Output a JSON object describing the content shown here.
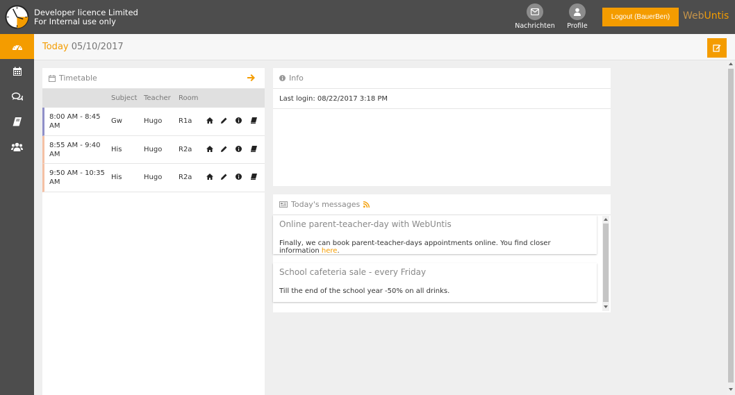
{
  "header": {
    "licence_line1": "Developer licence Limited",
    "licence_line2": "For Internal use only",
    "messages_label": "Nachrichten",
    "profile_label": "Profile",
    "logout_label": "Logout (BauerBen)",
    "brand_web": "Web",
    "brand_untis": "Untis",
    "icons": [
      "clock-logo",
      "envelope-icon",
      "user-icon"
    ]
  },
  "sidebar": {
    "items": [
      {
        "name": "dashboard",
        "icon": "dashboard-icon",
        "active": true
      },
      {
        "name": "calendar",
        "icon": "calendar-icon",
        "active": false
      },
      {
        "name": "messages",
        "icon": "chat-icon",
        "active": false
      },
      {
        "name": "book",
        "icon": "book-icon",
        "active": false
      },
      {
        "name": "groups",
        "icon": "users-icon",
        "active": false
      }
    ]
  },
  "subheader": {
    "today_label": "Today",
    "date": "05/10/2017"
  },
  "timetable": {
    "title": "Timetable",
    "columns": [
      "Subject",
      "Teacher",
      "Room"
    ],
    "rows": [
      {
        "time_line1": "8:00 AM - 8:45",
        "time_line2": "AM",
        "subject": "Gw",
        "teacher": "Hugo",
        "room": "R1a",
        "color": "#8f8fc8"
      },
      {
        "time_line1": "8:55 AM - 9:40",
        "time_line2": "AM",
        "subject": "His",
        "teacher": "Hugo",
        "room": "R2a",
        "color": "#f4c0a4"
      },
      {
        "time_line1": "9:50 AM - 10:35",
        "time_line2": "AM",
        "subject": "His",
        "teacher": "Hugo",
        "room": "R2a",
        "color": "#f4c0a4"
      }
    ],
    "row_icons": [
      "home-icon",
      "pencil-icon",
      "info-icon",
      "book-icon"
    ]
  },
  "info": {
    "title": "Info",
    "last_login": "Last login: 08/22/2017 3:18 PM"
  },
  "messages": {
    "title": "Today's messages",
    "items": [
      {
        "title": "Online parent-teacher-day with WebUntis",
        "body": "Finally, we can book parent-teacher-days appointments online. You find closer information ",
        "link": "here",
        "after_link": "."
      },
      {
        "title": "School cafeteria sale - every Friday",
        "body": "Till the end of the school year -50% on all drinks.",
        "link": "",
        "after_link": ""
      }
    ]
  },
  "colors": {
    "accent": "#f49c00",
    "header_bg": "#4d4d4d"
  }
}
